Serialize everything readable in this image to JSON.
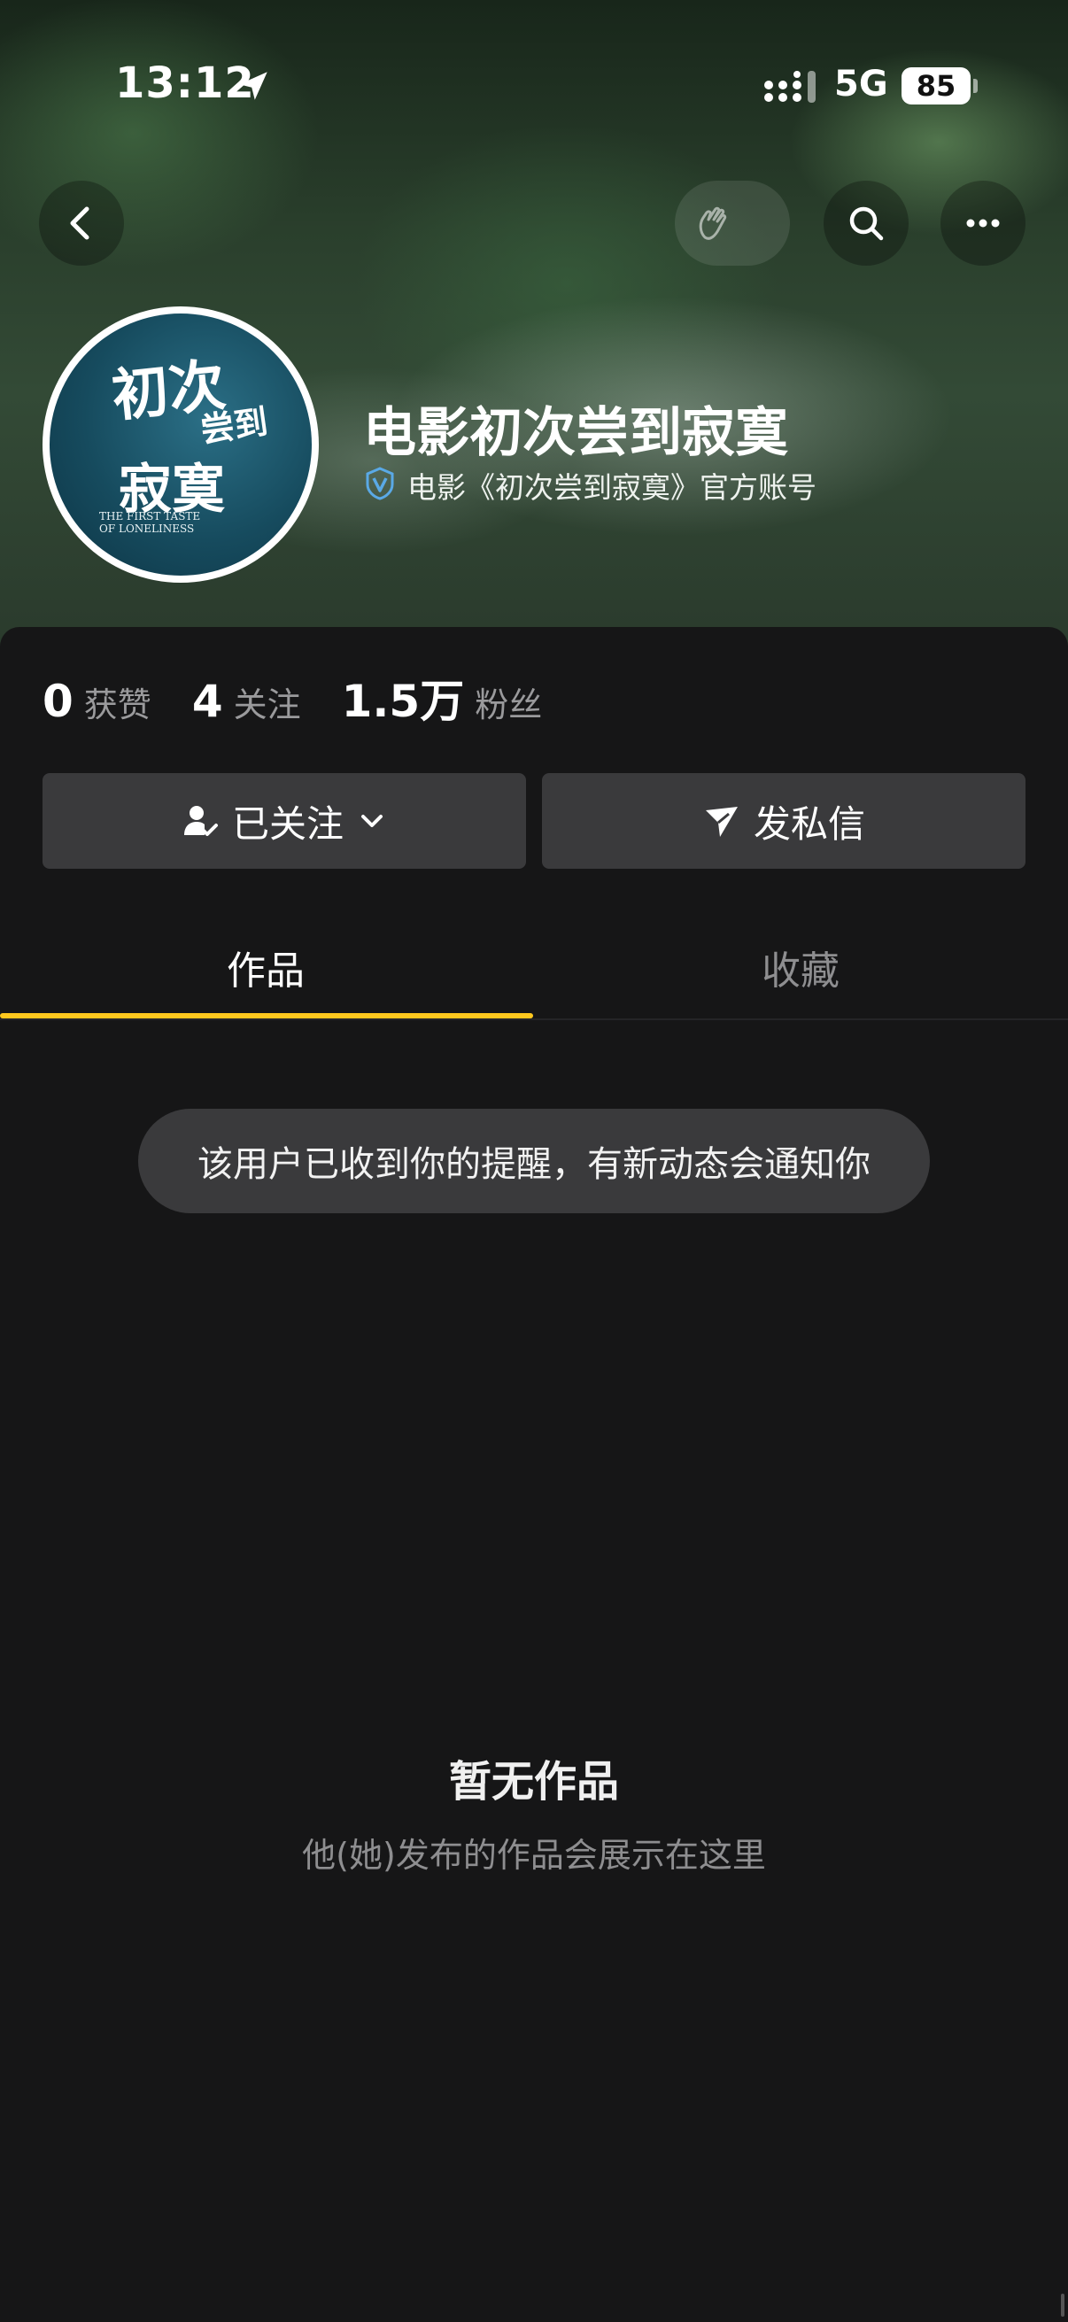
{
  "status_bar": {
    "time": "13:12",
    "network": "5G",
    "battery": "85"
  },
  "profile": {
    "name": "电影初次尝到寂寞",
    "verification": "电影《初次尝到寂寞》官方账号",
    "avatar": {
      "line1": "初次",
      "line2": "尝到",
      "line3": "寂寞",
      "en1": "THE FIRST TASTE",
      "en2": "OF LONELINESS"
    }
  },
  "stats": [
    {
      "value": "0",
      "label": "获赞"
    },
    {
      "value": "4",
      "label": "关注"
    },
    {
      "value": "1.5万",
      "label": "粉丝"
    }
  ],
  "actions": {
    "follow_label": "已关注",
    "message_label": "发私信"
  },
  "tabs": [
    {
      "label": "作品",
      "active": true
    },
    {
      "label": "收藏",
      "active": false
    }
  ],
  "toast": "该用户已收到你的提醒，有新动态会通知你",
  "empty_state": {
    "title": "暂无作品",
    "subtitle": "他(她)发布的作品会展示在这里"
  },
  "colors": {
    "accent": "#ffc81e",
    "background": "#161617",
    "button": "#3a3a3c",
    "verify": "#5aa9e6"
  },
  "icons": [
    "location-arrow-icon",
    "signal-icon",
    "back-icon",
    "wave-icon",
    "search-icon",
    "more-icon",
    "verified-icon",
    "user-check-icon",
    "chevron-down-icon",
    "send-icon"
  ]
}
